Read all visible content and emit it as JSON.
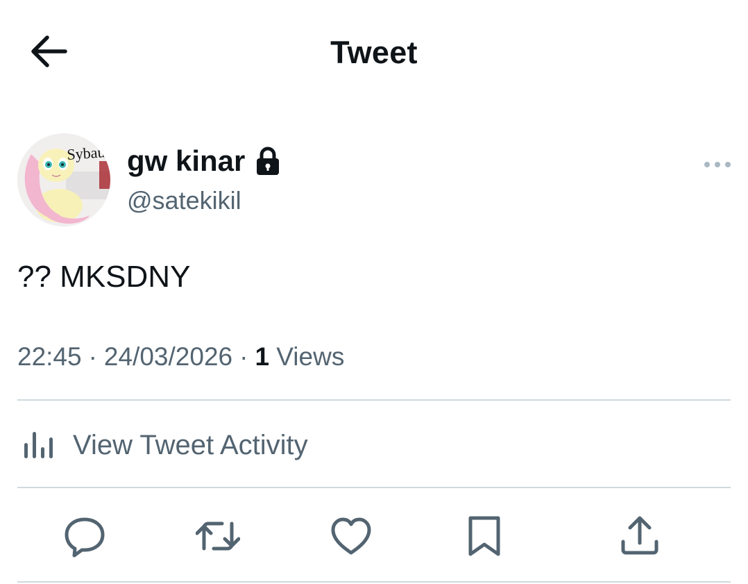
{
  "header": {
    "back_icon": "arrow-left-icon",
    "title": "Tweet"
  },
  "tweet": {
    "author": {
      "display_name": "gw kinar",
      "handle": "@satekikil",
      "protected_icon": "lock-icon",
      "avatar_text": "Sybau"
    },
    "more_icon": "more-horizontal-icon",
    "text": "?? MKSDNY",
    "time": "22:45",
    "date": "24/03/2026",
    "separator": "·",
    "views_count": "1",
    "views_label": "Views"
  },
  "activity": {
    "icon": "bar-chart-icon",
    "label": "View Tweet Activity"
  },
  "actions": [
    {
      "name": "reply",
      "icon": "reply-icon"
    },
    {
      "name": "retweet",
      "icon": "retweet-icon"
    },
    {
      "name": "like",
      "icon": "heart-icon"
    },
    {
      "name": "bookmark",
      "icon": "bookmark-icon"
    },
    {
      "name": "share",
      "icon": "share-icon"
    }
  ],
  "colors": {
    "text_primary": "#0f1419",
    "text_secondary": "#536471",
    "divider": "#cfd9de",
    "icon": "#536471"
  }
}
